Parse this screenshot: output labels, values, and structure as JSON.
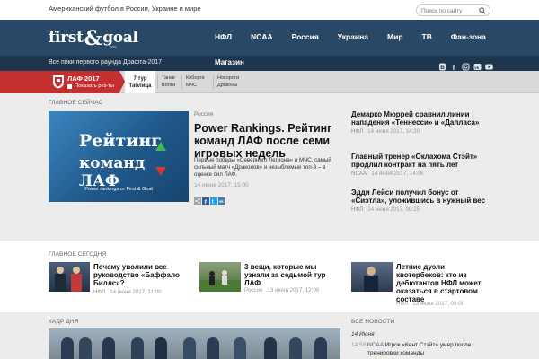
{
  "topbar": {
    "tagline": "Американский футбол в России, Украине и мире",
    "search_placeholder": "Поиск по сайту"
  },
  "header": {
    "logo_first": "first",
    "logo_amp": "&",
    "logo_goal": "goal",
    "logo_sub": "bets",
    "nav": [
      "НФЛ",
      "NCAA",
      "Россия",
      "Украина",
      "Мир",
      "ТВ",
      "Фан-зона"
    ]
  },
  "subbar": {
    "left_link": "Все пики первого раунда Драфта-2017",
    "shop": "Магазин",
    "social_icons": [
      "blogger-icon",
      "facebook-icon",
      "instagram-icon",
      "vk-icon",
      "youtube-icon"
    ]
  },
  "leaguebar": {
    "title": "ЛАФ 2017",
    "checkbox_label": "Показать рез-ты",
    "tour_label": "7 тур",
    "table_label": "Таблица",
    "matches": [
      {
        "home": "Танки",
        "away": "Волки"
      },
      {
        "home": "Киборги",
        "away": "МЧС"
      },
      {
        "home": "Носороги",
        "away": "Драконы"
      }
    ]
  },
  "sections": {
    "now": "ГЛАВНОЕ СЕЙЧАС",
    "today": "ГЛАВНОЕ СЕГОДНЯ",
    "photo": "КАДР ДНЯ",
    "all_news": "ВСЕ НОВОСТИ"
  },
  "hero": {
    "line1": "Рейтинг",
    "line2": "команд ЛАФ",
    "caption": "Power rankings от First & Goal"
  },
  "main_story": {
    "tag": "Россия",
    "title": "Power Rankings. Рейтинг команд ЛАФ после семи игровых недель",
    "desc": "Первые победы «Северного Легиона» и МЧС, самый сильный матч «Драконов» и незыблемые топ-3 – в оценке сил ЛАФ.",
    "date": "14 июня 2017, 15:00"
  },
  "right_news": [
    {
      "title": "Демарко Мюррей сравнил линии нападения «Теннесси» и «Далласа»",
      "cat": "НФЛ",
      "date": "14 июня 2017, 14:20"
    },
    {
      "title": "Главный тренер «Оклахома Стэйт» продлил контракт на пять лет",
      "cat": "NCAA",
      "date": "14 июня 2017, 14:06"
    },
    {
      "title": "Эдди Лейси получил бонус от «Сиэтла», уложившись в нужный вес",
      "cat": "НФЛ",
      "date": "14 июня 2017, 00:25"
    }
  ],
  "today_stories": [
    {
      "title": "Почему уволили все руководство «Баффало Биллс»?",
      "cat": "НФЛ",
      "date": "14 июня 2017, 11:00"
    },
    {
      "title": "3 вещи, которые мы узнали за седьмой тур ЛАФ",
      "cat": "Россия",
      "date": "13 июня 2017, 12:00"
    },
    {
      "title": "Летние дуэли квотербеков: кто из дебютантов НФЛ может оказаться в стартовом составе",
      "cat": "НФЛ",
      "date": "13 июня 2017, 09:00"
    }
  ],
  "all_news": {
    "date": "14 Июня",
    "time": "14:58",
    "cat": "NCAA",
    "text": "Игрок «Кент Стэйт» умер после тренировки команды"
  },
  "colors": {
    "header": "#294865",
    "subbar": "#1d364d",
    "laf_red": "#c62f2f",
    "link_blue": "#2f5f8e"
  }
}
